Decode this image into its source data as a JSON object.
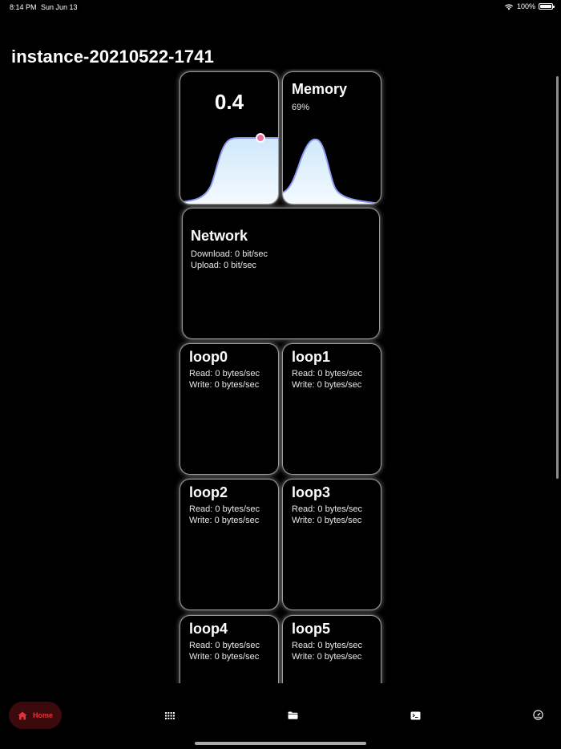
{
  "status_bar": {
    "time": "8:14 PM",
    "date": "Sun Jun 13",
    "battery": "100%"
  },
  "page": {
    "title": "instance-20210522-1741"
  },
  "cpu": {
    "value": "0.4"
  },
  "memory": {
    "title": "Memory",
    "percent": "69%"
  },
  "network": {
    "title": "Network",
    "download": "Download: 0 bit/sec",
    "upload": "Upload: 0 bit/sec"
  },
  "disks": [
    {
      "name": "loop0",
      "read": "Read: 0 bytes/sec",
      "write": "Write: 0 bytes/sec"
    },
    {
      "name": "loop1",
      "read": "Read: 0 bytes/sec",
      "write": "Write: 0 bytes/sec"
    },
    {
      "name": "loop2",
      "read": "Read: 0 bytes/sec",
      "write": "Write: 0 bytes/sec"
    },
    {
      "name": "loop3",
      "read": "Read: 0 bytes/sec",
      "write": "Write: 0 bytes/sec"
    },
    {
      "name": "loop4",
      "read": "Read: 0 bytes/sec",
      "write": "Write: 0 bytes/sec"
    },
    {
      "name": "loop5",
      "read": "Read: 0 bytes/sec",
      "write": "Write: 0 bytes/sec"
    }
  ],
  "tab_bar": {
    "home_label": "Home",
    "home_icon": "house-icon",
    "apps_icon": "grid-icon",
    "files_icon": "folder-icon",
    "terminal_icon": "terminal-icon",
    "dashboard_icon": "gauge-icon",
    "active_color": "#e0333a"
  },
  "colors": {
    "chart_fill": "#d9eefc",
    "chart_line": "#8f9cf5",
    "marker": "#ef6fa0"
  }
}
